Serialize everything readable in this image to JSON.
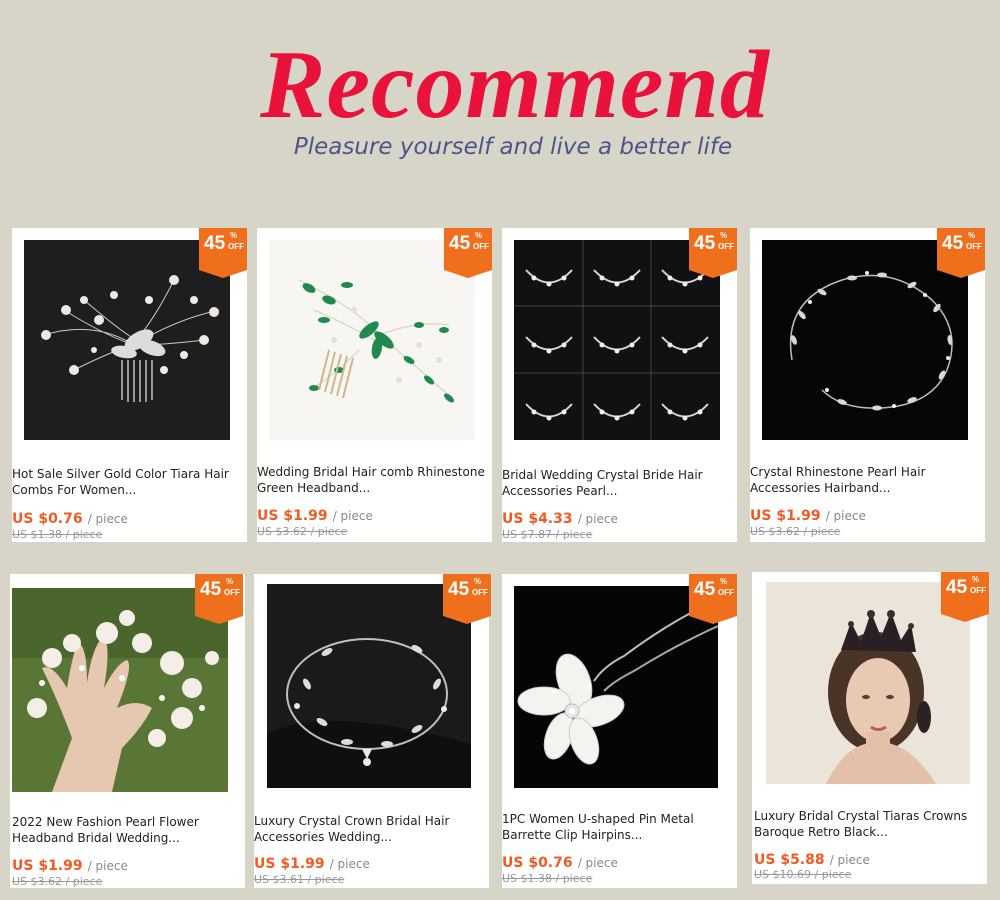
{
  "header": {
    "title": "Recommend",
    "subtitle": "Pleasure yourself and live a better life"
  },
  "colors": {
    "accent": "#e8123a",
    "badge": "#f06f1c",
    "price": "#f15a22",
    "background": "#d6d5c7"
  },
  "products": [
    {
      "title1": "Hot Sale Silver Gold Color Tiara Hair",
      "title2": "Combs For Women...",
      "price": "US $0.76",
      "unit": "/ piece",
      "old_price": "US $1.38 / piece",
      "discount": "45",
      "pct": "%",
      "off": "OFF",
      "image": "silver-pearl-hair-comb"
    },
    {
      "title1": "Wedding Bridal Hair comb Rhinestone",
      "title2": "Green Headband...",
      "price": "US $1.99",
      "unit": "/ piece",
      "old_price": "US $3.62 / piece",
      "discount": "45",
      "pct": "%",
      "off": "OFF",
      "image": "green-rhinestone-hair-comb"
    },
    {
      "title1": "Bridal Wedding Crystal Bride Hair",
      "title2": "Accessories Pearl...",
      "price": "US $4.33",
      "unit": "/ piece",
      "old_price": "US $7.87 / piece",
      "discount": "45",
      "pct": "%",
      "off": "OFF",
      "image": "crystal-hair-accessories-grid"
    },
    {
      "title1": "Crystal Rhinestone Pearl Hair",
      "title2": "Accessories Hairband...",
      "price": "US $1.99",
      "unit": "/ piece",
      "old_price": "US $3.62 / piece",
      "discount": "45",
      "pct": "%",
      "off": "OFF",
      "image": "rhinestone-pearl-hairband"
    },
    {
      "title1": "2022 New Fashion Pearl Flower",
      "title2": "Headband Bridal Wedding...",
      "price": "US $1.99",
      "unit": "/ piece",
      "old_price": "US $3.62 / piece",
      "discount": "45",
      "pct": "%",
      "off": "OFF",
      "image": "pearl-flower-headband-hand"
    },
    {
      "title1": "Luxury Crystal Crown Bridal Hair",
      "title2": "Accessories Wedding...",
      "price": "US $1.99",
      "unit": "/ piece",
      "old_price": "US $3.61 / piece",
      "discount": "45",
      "pct": "%",
      "off": "OFF",
      "image": "crystal-crown-headband"
    },
    {
      "title1": "1PC Women U-shaped Pin Metal",
      "title2": "Barrette Clip Hairpins...",
      "price": "US $0.76",
      "unit": "/ piece",
      "old_price": "US $1.38 / piece",
      "discount": "45",
      "pct": "%",
      "off": "OFF",
      "image": "flower-u-pin"
    },
    {
      "title1": "Luxury Bridal Crystal Tiaras Crowns",
      "title2": "Baroque Retro Black...",
      "price": "US $5.88",
      "unit": "/ piece",
      "old_price": "US $10.69 / piece",
      "discount": "45",
      "pct": "%",
      "off": "OFF",
      "image": "baroque-black-tiara"
    }
  ]
}
